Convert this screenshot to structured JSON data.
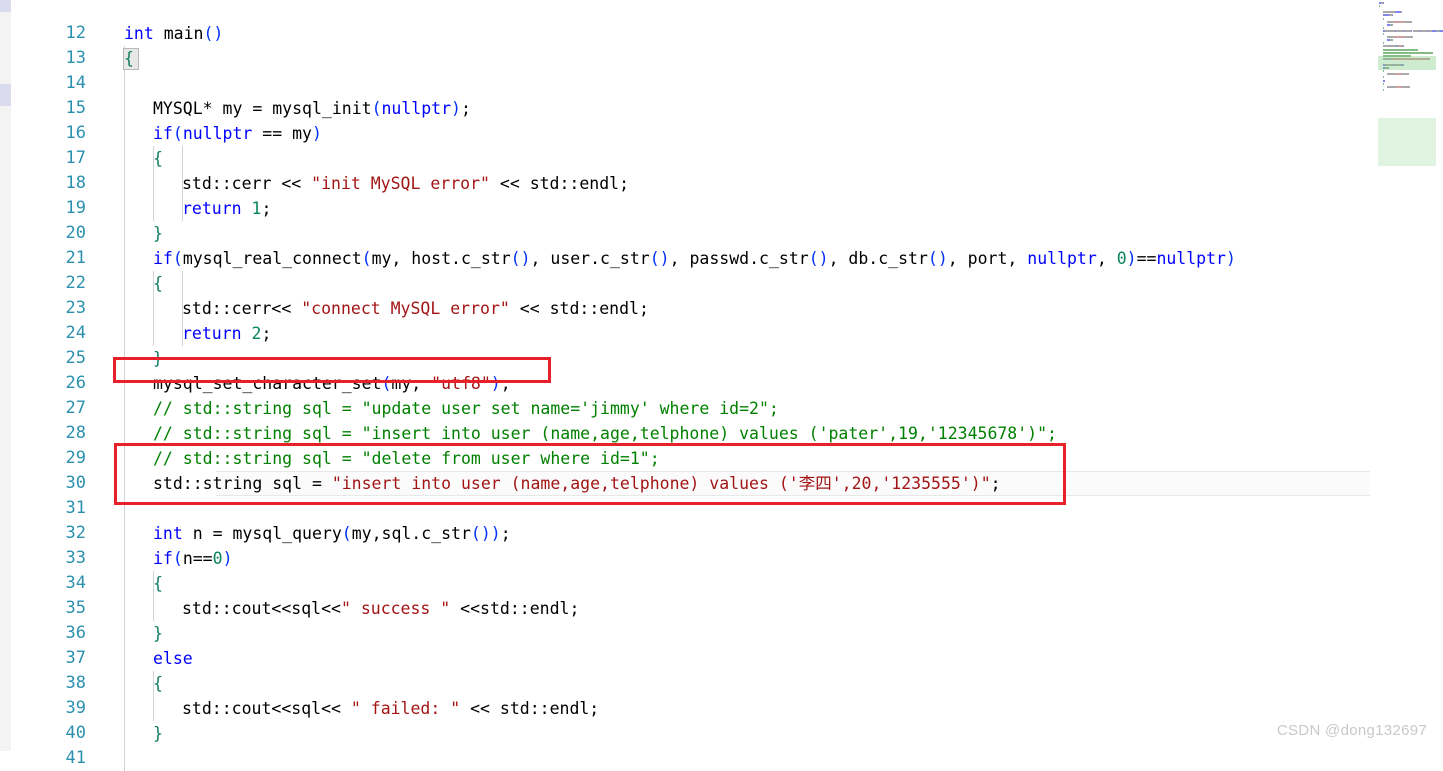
{
  "editor": {
    "app": "code-editor",
    "language": "cpp",
    "first_visible_line": 11,
    "active_line": 30,
    "colors": {
      "keyword": "#0000ff",
      "string": "#a31515",
      "comment": "#008000",
      "number": "#098658",
      "function_paren": "#0431fa",
      "brace": "#0f7b5f",
      "line_number": "#2b91af",
      "annotation_box": "#e8202a",
      "active_line_bg": "#fbfbfb",
      "watermark": "#c9c9c9"
    }
  },
  "lines": [
    {
      "num": "12",
      "indent": 0,
      "tokens": [
        {
          "t": "int ",
          "c": "kw"
        },
        {
          "t": "main",
          "c": "plain"
        },
        {
          "t": "()",
          "c": "paren"
        }
      ]
    },
    {
      "num": "13",
      "indent": 0,
      "tokens": [
        {
          "t": "{",
          "c": "brace"
        }
      ]
    },
    {
      "num": "14",
      "indent": 0,
      "tokens": []
    },
    {
      "num": "15",
      "indent": 1,
      "tokens": [
        {
          "t": "MYSQL",
          "c": "plain"
        },
        {
          "t": "* my = ",
          "c": "plain"
        },
        {
          "t": "mysql_init",
          "c": "plain"
        },
        {
          "t": "(",
          "c": "paren"
        },
        {
          "t": "nullptr",
          "c": "kw"
        },
        {
          "t": ")",
          "c": "paren"
        },
        {
          "t": ";",
          "c": "plain"
        }
      ]
    },
    {
      "num": "16",
      "indent": 1,
      "tokens": [
        {
          "t": "if",
          "c": "kw"
        },
        {
          "t": "(",
          "c": "paren"
        },
        {
          "t": "nullptr",
          "c": "kw"
        },
        {
          "t": " == my",
          "c": "plain"
        },
        {
          "t": ")",
          "c": "paren"
        }
      ]
    },
    {
      "num": "17",
      "indent": 1,
      "tokens": [
        {
          "t": "{",
          "c": "brace"
        }
      ]
    },
    {
      "num": "18",
      "indent": 2,
      "tokens": [
        {
          "t": "std::cerr << ",
          "c": "plain"
        },
        {
          "t": "\"init MySQL error\"",
          "c": "str"
        },
        {
          "t": " << std::endl;",
          "c": "plain"
        }
      ]
    },
    {
      "num": "19",
      "indent": 2,
      "tokens": [
        {
          "t": "return",
          "c": "kw"
        },
        {
          "t": " ",
          "c": "plain"
        },
        {
          "t": "1",
          "c": "num"
        },
        {
          "t": ";",
          "c": "plain"
        }
      ]
    },
    {
      "num": "20",
      "indent": 1,
      "tokens": [
        {
          "t": "}",
          "c": "brace"
        }
      ]
    },
    {
      "num": "21",
      "indent": 1,
      "tokens": [
        {
          "t": "if",
          "c": "kw"
        },
        {
          "t": "(",
          "c": "paren"
        },
        {
          "t": "mysql_real_connect",
          "c": "plain"
        },
        {
          "t": "(",
          "c": "paren"
        },
        {
          "t": "my, host.c_str",
          "c": "plain"
        },
        {
          "t": "()",
          "c": "paren"
        },
        {
          "t": ", user.c_str",
          "c": "plain"
        },
        {
          "t": "()",
          "c": "paren"
        },
        {
          "t": ", passwd.c_str",
          "c": "plain"
        },
        {
          "t": "()",
          "c": "paren"
        },
        {
          "t": ", db.c_str",
          "c": "plain"
        },
        {
          "t": "()",
          "c": "paren"
        },
        {
          "t": ", port, ",
          "c": "plain"
        },
        {
          "t": "nullptr",
          "c": "kw"
        },
        {
          "t": ", ",
          "c": "plain"
        },
        {
          "t": "0",
          "c": "num"
        },
        {
          "t": ")",
          "c": "paren"
        },
        {
          "t": "==",
          "c": "plain"
        },
        {
          "t": "nullptr",
          "c": "kw"
        },
        {
          "t": ")",
          "c": "paren"
        }
      ]
    },
    {
      "num": "22",
      "indent": 1,
      "tokens": [
        {
          "t": "{",
          "c": "brace"
        }
      ]
    },
    {
      "num": "23",
      "indent": 2,
      "tokens": [
        {
          "t": "std::cerr<< ",
          "c": "plain"
        },
        {
          "t": "\"connect MySQL error\"",
          "c": "str"
        },
        {
          "t": " << std::endl;",
          "c": "plain"
        }
      ]
    },
    {
      "num": "24",
      "indent": 2,
      "tokens": [
        {
          "t": "return",
          "c": "kw"
        },
        {
          "t": " ",
          "c": "plain"
        },
        {
          "t": "2",
          "c": "num"
        },
        {
          "t": ";",
          "c": "plain"
        }
      ]
    },
    {
      "num": "25",
      "indent": 1,
      "tokens": [
        {
          "t": "}",
          "c": "brace"
        }
      ]
    },
    {
      "num": "26",
      "indent": 1,
      "tokens": [
        {
          "t": "mysql_set_character_set",
          "c": "plain"
        },
        {
          "t": "(",
          "c": "paren"
        },
        {
          "t": "my, ",
          "c": "plain"
        },
        {
          "t": "\"utf8\"",
          "c": "str"
        },
        {
          "t": ")",
          "c": "paren"
        },
        {
          "t": ";",
          "c": "plain"
        }
      ]
    },
    {
      "num": "27",
      "indent": 1,
      "tokens": [
        {
          "t": "// std::string sql = \"update user set name='jimmy' where id=2\";",
          "c": "cmt"
        }
      ]
    },
    {
      "num": "28",
      "indent": 1,
      "tokens": [
        {
          "t": "// std::string sql = \"insert into user (name,age,telphone) values ('pater',19,'12345678')\";",
          "c": "cmt"
        }
      ]
    },
    {
      "num": "29",
      "indent": 1,
      "tokens": [
        {
          "t": "// std::string sql = \"delete from user where id=1\";",
          "c": "cmt"
        }
      ]
    },
    {
      "num": "30",
      "indent": 1,
      "tokens": [
        {
          "t": "std::string sql = ",
          "c": "plain"
        },
        {
          "t": "\"insert into user (name,age,telphone) values ('李四',20,'1235555')\"",
          "c": "str"
        },
        {
          "t": ";",
          "c": "plain"
        }
      ]
    },
    {
      "num": "31",
      "indent": 1,
      "tokens": []
    },
    {
      "num": "32",
      "indent": 1,
      "tokens": [
        {
          "t": "int",
          "c": "kw"
        },
        {
          "t": " n = ",
          "c": "plain"
        },
        {
          "t": "mysql_query",
          "c": "plain"
        },
        {
          "t": "(",
          "c": "paren"
        },
        {
          "t": "my,sql.c_str",
          "c": "plain"
        },
        {
          "t": "()",
          "c": "paren"
        },
        {
          "t": ")",
          "c": "paren"
        },
        {
          "t": ";",
          "c": "plain"
        }
      ]
    },
    {
      "num": "33",
      "indent": 1,
      "tokens": [
        {
          "t": "if",
          "c": "kw"
        },
        {
          "t": "(",
          "c": "paren"
        },
        {
          "t": "n==",
          "c": "plain"
        },
        {
          "t": "0",
          "c": "num"
        },
        {
          "t": ")",
          "c": "paren"
        }
      ]
    },
    {
      "num": "34",
      "indent": 1,
      "tokens": [
        {
          "t": "{",
          "c": "brace"
        }
      ]
    },
    {
      "num": "35",
      "indent": 2,
      "tokens": [
        {
          "t": "std::cout<<sql<<",
          "c": "plain"
        },
        {
          "t": "\" success \"",
          "c": "str"
        },
        {
          "t": " <<std::endl;",
          "c": "plain"
        }
      ]
    },
    {
      "num": "36",
      "indent": 1,
      "tokens": [
        {
          "t": "}",
          "c": "brace"
        }
      ]
    },
    {
      "num": "37",
      "indent": 1,
      "tokens": [
        {
          "t": "else",
          "c": "kw"
        }
      ]
    },
    {
      "num": "38",
      "indent": 1,
      "tokens": [
        {
          "t": "{",
          "c": "brace"
        }
      ]
    },
    {
      "num": "39",
      "indent": 2,
      "tokens": [
        {
          "t": "std::cout<<sql<< ",
          "c": "plain"
        },
        {
          "t": "\" failed: \"",
          "c": "str"
        },
        {
          "t": " << std::endl;",
          "c": "plain"
        }
      ]
    },
    {
      "num": "40",
      "indent": 1,
      "tokens": [
        {
          "t": "}",
          "c": "brace"
        }
      ]
    },
    {
      "num": "41",
      "indent": 0,
      "tokens": []
    }
  ],
  "annotations": [
    {
      "label": "set-charset-highlight",
      "target_line": "26"
    },
    {
      "label": "active-sql-statement-highlight",
      "target_line": "30"
    }
  ],
  "watermark": {
    "text": "CSDN @dong132697"
  },
  "minimap": {
    "visible": true,
    "lines": 46
  }
}
